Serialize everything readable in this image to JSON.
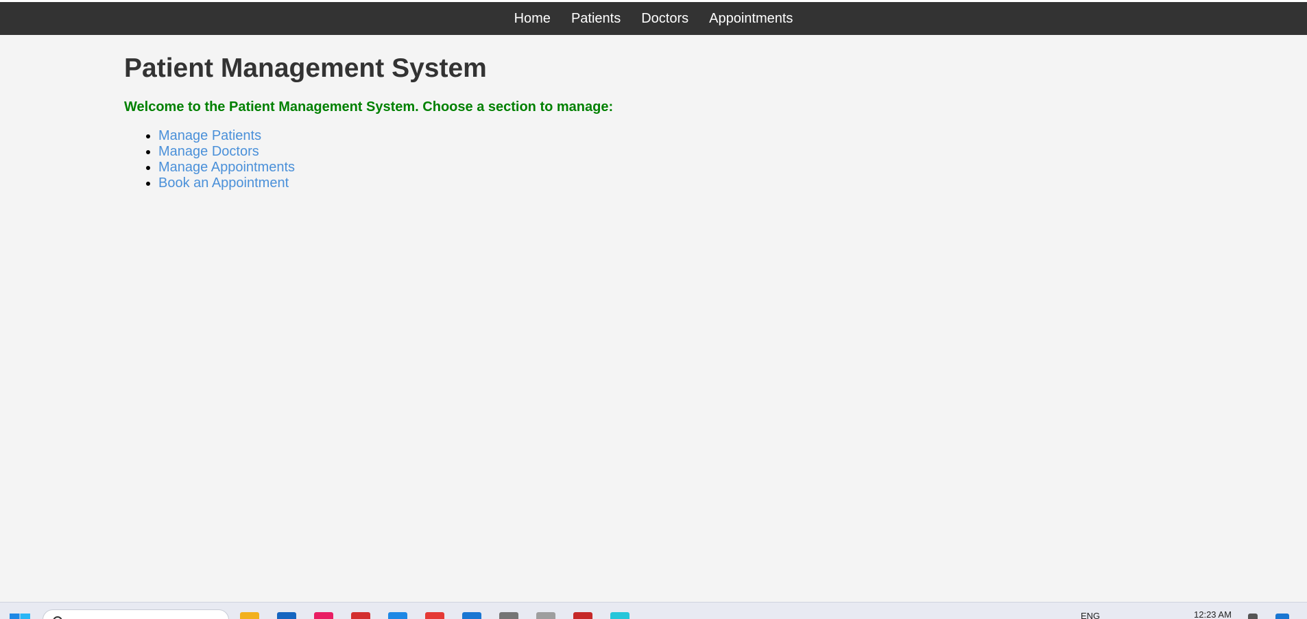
{
  "nav": {
    "items": [
      {
        "label": "Home"
      },
      {
        "label": "Patients"
      },
      {
        "label": "Doctors"
      },
      {
        "label": "Appointments"
      }
    ]
  },
  "main": {
    "title": "Patient Management System",
    "welcome": "Welcome to the Patient Management System. Choose a section to manage:",
    "links": [
      {
        "label": "Manage Patients"
      },
      {
        "label": "Manage Doctors"
      },
      {
        "label": "Manage Appointments"
      },
      {
        "label": "Book an Appointment"
      }
    ]
  },
  "taskbar": {
    "language": "ENG",
    "time": "12:23 AM",
    "apps": [
      {
        "icon": "file-explorer-icon",
        "color": "#f2b01e"
      },
      {
        "icon": "calendar-icon",
        "color": "#1565c0"
      },
      {
        "icon": "browser-icon",
        "color": "#e91e63"
      },
      {
        "icon": "opera-icon",
        "color": "#d32f2f"
      },
      {
        "icon": "store-icon",
        "color": "#1e88e5"
      },
      {
        "icon": "chrome-icon",
        "color": "#e53935"
      },
      {
        "icon": "vscode-icon",
        "color": "#1976d2"
      },
      {
        "icon": "terminal-icon",
        "color": "#757575"
      },
      {
        "icon": "settings-icon",
        "color": "#9e9e9e"
      },
      {
        "icon": "acrobat-icon",
        "color": "#c62828"
      },
      {
        "icon": "edge-icon",
        "color": "#26c6da"
      }
    ]
  },
  "colors": {
    "navbar_bg": "#333333",
    "page_bg": "#f4f4f4",
    "welcome_text": "#008000",
    "link": "#4a90d9"
  }
}
